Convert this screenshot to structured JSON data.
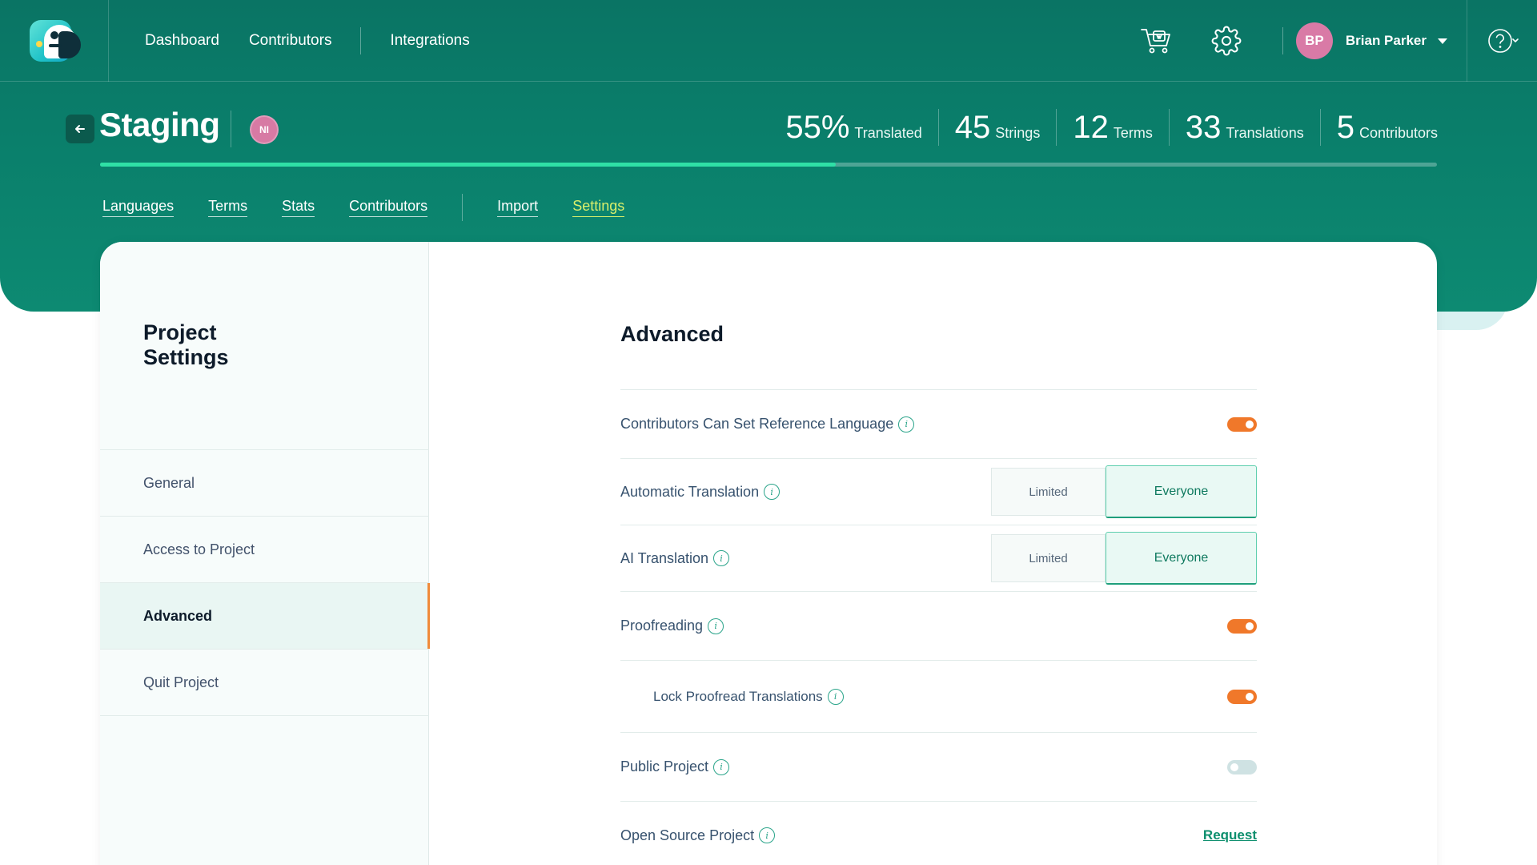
{
  "topnav": {
    "links": [
      "Dashboard",
      "Contributors",
      "Integrations"
    ],
    "user": {
      "initials": "BP",
      "name": "Brian Parker"
    }
  },
  "project": {
    "title": "Staging",
    "badge": "NI",
    "progress_percent": 55
  },
  "stats": [
    {
      "value": "55%",
      "label": "Translated"
    },
    {
      "value": "45",
      "label": "Strings"
    },
    {
      "value": "12",
      "label": "Terms"
    },
    {
      "value": "33",
      "label": "Translations"
    },
    {
      "value": "5",
      "label": "Contributors"
    }
  ],
  "subtabs": {
    "items": [
      "Languages",
      "Terms",
      "Stats",
      "Contributors",
      "Import",
      "Settings"
    ],
    "active": "Settings"
  },
  "sidebar": {
    "title": "Project Settings",
    "items": [
      "General",
      "Access to Project",
      "Advanced",
      "Quit Project"
    ],
    "active": "Advanced"
  },
  "content": {
    "title": "Advanced",
    "settings": [
      {
        "label": "Contributors Can Set Reference Language",
        "control": "toggle",
        "on": true
      },
      {
        "label": "Automatic Translation",
        "control": "segmented",
        "options": [
          "Limited",
          "Everyone"
        ],
        "selected": "Everyone"
      },
      {
        "label": "AI Translation",
        "control": "segmented",
        "options": [
          "Limited",
          "Everyone"
        ],
        "selected": "Everyone"
      },
      {
        "label": "Proofreading",
        "control": "toggle",
        "on": true
      },
      {
        "label": "Lock Proofread Translations",
        "control": "toggle",
        "on": true
      },
      {
        "label": "Public Project",
        "control": "toggle",
        "on": false
      },
      {
        "label": "Open Source Project",
        "control": "link",
        "link_text": "Request"
      }
    ]
  },
  "colors": {
    "header_bg": "#0a7f6b",
    "accent_orange": "#f0782a",
    "active_tab": "#d9ef6b",
    "progress_fill": "#2fe0a6"
  }
}
